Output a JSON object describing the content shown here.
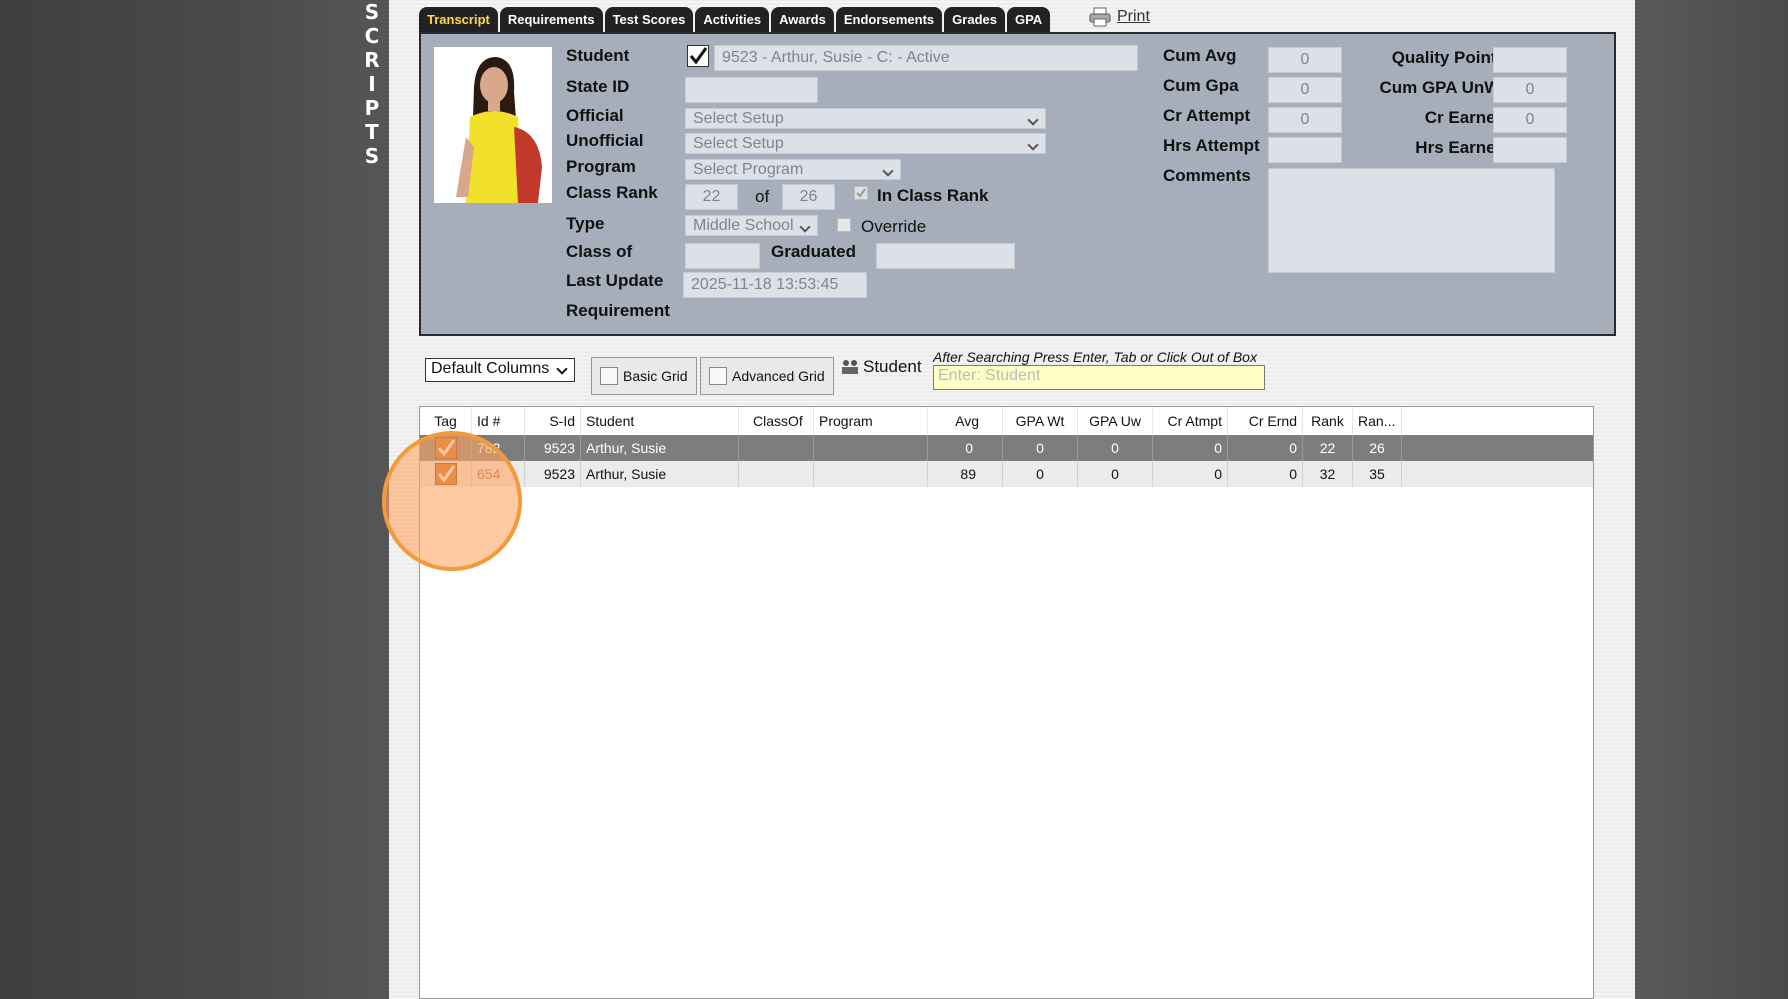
{
  "side_title_letters": [
    "S",
    "C",
    "R",
    "I",
    "P",
    "T",
    "S"
  ],
  "tabs": [
    {
      "label": "Transcript",
      "active": true
    },
    {
      "label": "Requirements",
      "active": false
    },
    {
      "label": "Test Scores",
      "active": false
    },
    {
      "label": "Activities",
      "active": false
    },
    {
      "label": "Awards",
      "active": false
    },
    {
      "label": "Endorsements",
      "active": false
    },
    {
      "label": "Grades",
      "active": false
    },
    {
      "label": "GPA",
      "active": false
    }
  ],
  "print_label": "Print",
  "student_panel": {
    "labels": {
      "student": "Student",
      "state_id": "State ID",
      "official": "Official",
      "unofficial": "Unofficial",
      "program": "Program",
      "class_rank": "Class Rank",
      "type": "Type",
      "class_of": "Class of",
      "last_update": "Last Update",
      "requirement": "Requirement",
      "graduated": "Graduated",
      "of": "of",
      "in_class_rank": "In Class Rank",
      "override": "Override"
    },
    "values": {
      "student": "9523 - Arthur, Susie - C:  - Active",
      "state_id": "",
      "official": "Select Setup",
      "unofficial": "Select Setup",
      "program": "Select Program",
      "rank": "22",
      "rank_of": "26",
      "type": "Middle School",
      "class_of": "",
      "graduated": "",
      "last_update": "2025-11-18 13:53:45"
    }
  },
  "stats_panel": {
    "labels": {
      "cum_avg": "Cum Avg",
      "cum_gpa": "Cum Gpa",
      "cr_attempt": "Cr Attempt",
      "hrs_attempt": "Hrs Attempt",
      "comments": "Comments",
      "quality_points": "Quality Points",
      "cum_gpa_unwt": "Cum GPA UnWt",
      "cr_earned": "Cr Earned",
      "hrs_earned": "Hrs Earned"
    },
    "values": {
      "cum_avg": "0",
      "cum_gpa": "0",
      "cr_attempt": "0",
      "hrs_attempt": "",
      "quality_points": "",
      "cum_gpa_unwt": "0",
      "cr_earned": "0",
      "hrs_earned": ""
    }
  },
  "toolbar": {
    "columns_select": "Default Columns",
    "basic_grid": "Basic Grid",
    "advanced_grid": "Advanced Grid",
    "student_label": "Student",
    "search_hint": "After Searching Press Enter, Tab or Click Out of Box",
    "search_placeholder": "Enter: Student"
  },
  "grid": {
    "headers": [
      "Tag",
      "Id #",
      "S-Id",
      "Student",
      "ClassOf",
      "Program",
      "Avg",
      "GPA Wt",
      "GPA Uw",
      "Cr Atmpt",
      "Cr Ernd",
      "Rank",
      "Ran..."
    ],
    "rows": [
      {
        "id": "782",
        "sid": "9523",
        "student": "Arthur, Susie",
        "classof": "",
        "program": "",
        "avg": "0",
        "gpa_wt": "0",
        "gpa_uw": "0",
        "cr_atmpt": "0",
        "cr_ernd": "0",
        "rank": "22",
        "ran": "26"
      },
      {
        "id": "654",
        "sid": "9523",
        "student": "Arthur, Susie",
        "classof": "",
        "program": "",
        "avg": "89",
        "gpa_wt": "0",
        "gpa_uw": "0",
        "cr_atmpt": "0",
        "cr_ernd": "0",
        "rank": "32",
        "ran": "35"
      }
    ]
  },
  "colors": {
    "active_tab_text": "#ffd84a",
    "panel_bg": "#a6aebc",
    "highlight": "#f39a3d"
  }
}
